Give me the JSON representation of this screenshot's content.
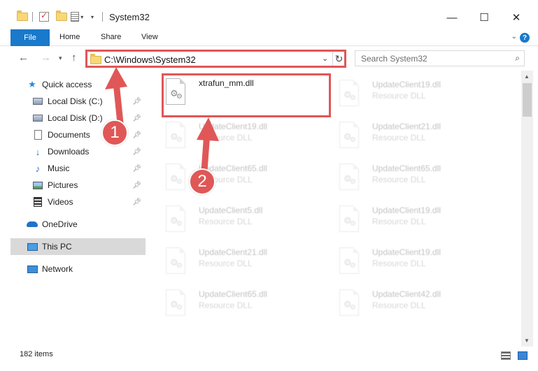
{
  "window": {
    "title": "System32",
    "minimize_glyph": "—",
    "maximize_glyph": "☐",
    "close_glyph": "✕"
  },
  "ribbon": {
    "file": "File",
    "tabs": [
      "Home",
      "Share",
      "View"
    ]
  },
  "address": {
    "path": "C:\\Windows\\System32",
    "search_placeholder": "Search System32"
  },
  "nav": {
    "quick_access": "Quick access",
    "items": [
      {
        "label": "Local Disk (C:)",
        "icon": "drive-icon",
        "pinned": true
      },
      {
        "label": "Local Disk (D:)",
        "icon": "drive-icon",
        "pinned": true
      },
      {
        "label": "Documents",
        "icon": "documents-icon",
        "pinned": true
      },
      {
        "label": "Downloads",
        "icon": "downloads-icon",
        "pinned": true
      },
      {
        "label": "Music",
        "icon": "music-icon",
        "pinned": true
      },
      {
        "label": "Pictures",
        "icon": "pictures-icon",
        "pinned": true
      },
      {
        "label": "Videos",
        "icon": "videos-icon",
        "pinned": true
      }
    ],
    "onedrive": "OneDrive",
    "this_pc": "This PC",
    "network": "Network"
  },
  "files": [
    {
      "name": "xtrafun_mm.dll",
      "type": "",
      "highlighted": true
    },
    {
      "name": "UpdateClient19.dll",
      "type": "Resource DLL"
    },
    {
      "name": "UpdateClient19.dll",
      "type": "Resource DLL"
    },
    {
      "name": "UpdateClient21.dll",
      "type": "Resource DLL"
    },
    {
      "name": "UpdateClient65.dll",
      "type": "Resource DLL"
    },
    {
      "name": "UpdateClient65.dll",
      "type": "Resource DLL"
    },
    {
      "name": "UpdateClient5.dll",
      "type": "Resource DLL"
    },
    {
      "name": "UpdateClient19.dll",
      "type": "Resource DLL"
    },
    {
      "name": "UpdateClient21.dll",
      "type": "Resource DLL"
    },
    {
      "name": "UpdateClient19.dll",
      "type": "Resource DLL"
    },
    {
      "name": "UpdateClient65.dll",
      "type": "Resource DLL"
    },
    {
      "name": "UpdateClient42.dll",
      "type": "Resource DLL"
    }
  ],
  "status": {
    "item_count": "182 items"
  },
  "annotations": {
    "step1": "1",
    "step2": "2",
    "color": "#e05757"
  }
}
